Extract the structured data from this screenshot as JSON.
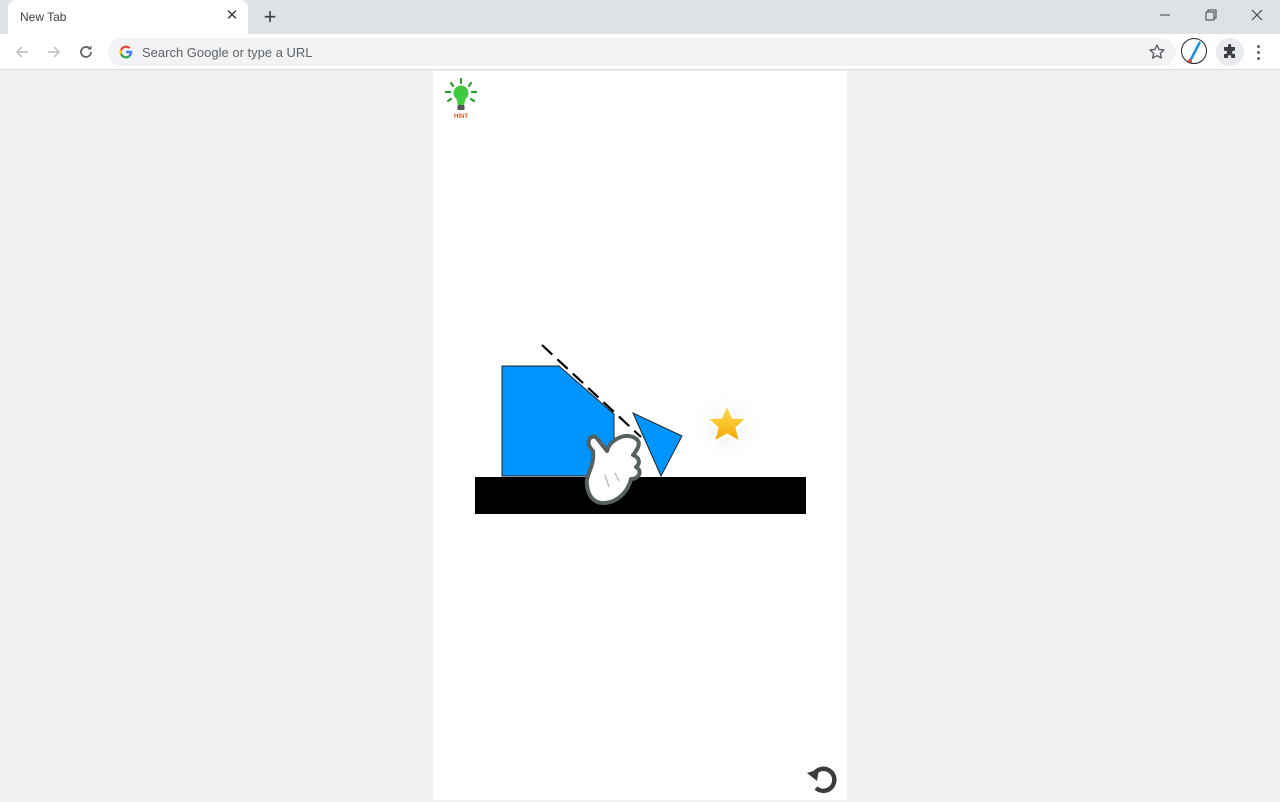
{
  "browser": {
    "tab_title": "New Tab",
    "tab_close_icon": "close-icon",
    "new_tab_icon": "plus-icon",
    "omnibox_placeholder": "Search Google or type a URL",
    "window_controls": [
      "minimize-icon",
      "restore-icon",
      "close-icon"
    ],
    "toolbar_icons": [
      "back-icon",
      "forward-icon",
      "reload-icon",
      "bookmark-star-icon",
      "profile-icon",
      "extensions-puzzle-icon",
      "more-menu-icon"
    ]
  },
  "game": {
    "hint_label": "HINT",
    "hint_icon": "lightbulb-icon",
    "restart_icon": "restart-icon",
    "colors": {
      "shape_fill": "#0094ff",
      "ground": "#000000",
      "star": "#f5b400",
      "cut_line": "#000000"
    },
    "objects": [
      "blue-pentagon-block",
      "blue-triangle-block",
      "ground-platform",
      "gold-star",
      "dashed-cut-line",
      "pointing-hand-hint"
    ]
  }
}
